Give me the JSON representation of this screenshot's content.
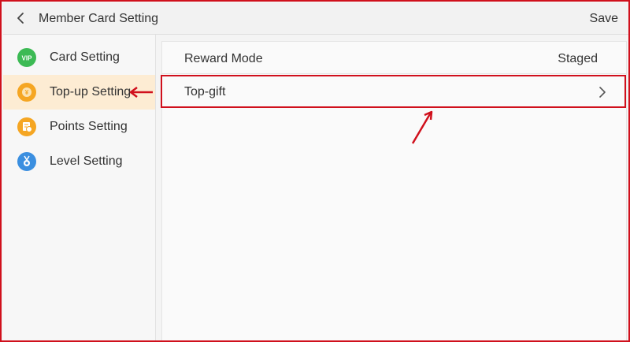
{
  "header": {
    "title": "Member Card Setting",
    "save_label": "Save",
    "back_icon": "chevron-left-icon"
  },
  "sidebar": {
    "items": [
      {
        "label": "Card Setting",
        "icon": "vip-icon",
        "icon_text": "VIP",
        "color": "#3cba54",
        "active": false
      },
      {
        "label": "Top-up Setting",
        "icon": "coin-icon",
        "icon_text": "¥",
        "color": "#f5a623",
        "active": true
      },
      {
        "label": "Points Setting",
        "icon": "points-icon",
        "icon_text": "",
        "color": "#f5a623",
        "active": false
      },
      {
        "label": "Level Setting",
        "icon": "medal-icon",
        "icon_text": "",
        "color": "#3b8fe0",
        "active": false
      }
    ]
  },
  "main": {
    "reward_mode": {
      "label": "Reward Mode",
      "value": "Staged"
    },
    "top_gift": {
      "label": "Top-gift",
      "icon": "chevron-right-icon"
    }
  },
  "colors": {
    "annotation": "#d0101c",
    "active_bg": "#fdecd3"
  }
}
